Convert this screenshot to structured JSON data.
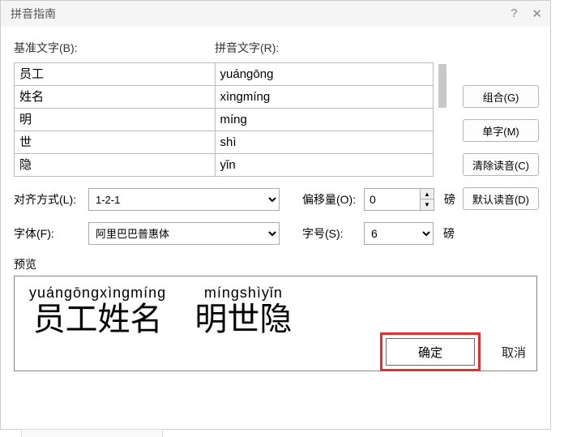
{
  "dialog": {
    "title": "拼音指南",
    "help_icon": "?",
    "close_icon": "✕"
  },
  "labels": {
    "base_text": "基准文字(B):",
    "ruby_text": "拼音文字(R):",
    "alignment": "对齐方式(L):",
    "offset": "偏移量(O):",
    "font": "字体(F):",
    "size": "字号(S):",
    "unit_point": "磅",
    "preview": "预览"
  },
  "rows": [
    {
      "base": "员工",
      "ruby": "yuángōng"
    },
    {
      "base": "姓名",
      "ruby": "xìngmíng"
    },
    {
      "base": "明",
      "ruby": "míng"
    },
    {
      "base": "世",
      "ruby": "shì"
    },
    {
      "base": "隐",
      "ruby": "yǐn"
    }
  ],
  "side_buttons": {
    "group": "组合(G)",
    "mono": "单字(M)",
    "clear": "清除读音(C)",
    "default": "默认读音(D)"
  },
  "form": {
    "alignment_value": "1-2-1",
    "offset_value": "0",
    "font_value": "阿里巴巴普惠体",
    "size_value": "6"
  },
  "preview": {
    "group1": {
      "ruby": "yuángōngxìngmíng",
      "base": "员工姓名"
    },
    "group2": {
      "ruby": "míngshìyǐn",
      "base": "明世隐"
    }
  },
  "footer": {
    "ok": "确定",
    "cancel": "取消"
  }
}
